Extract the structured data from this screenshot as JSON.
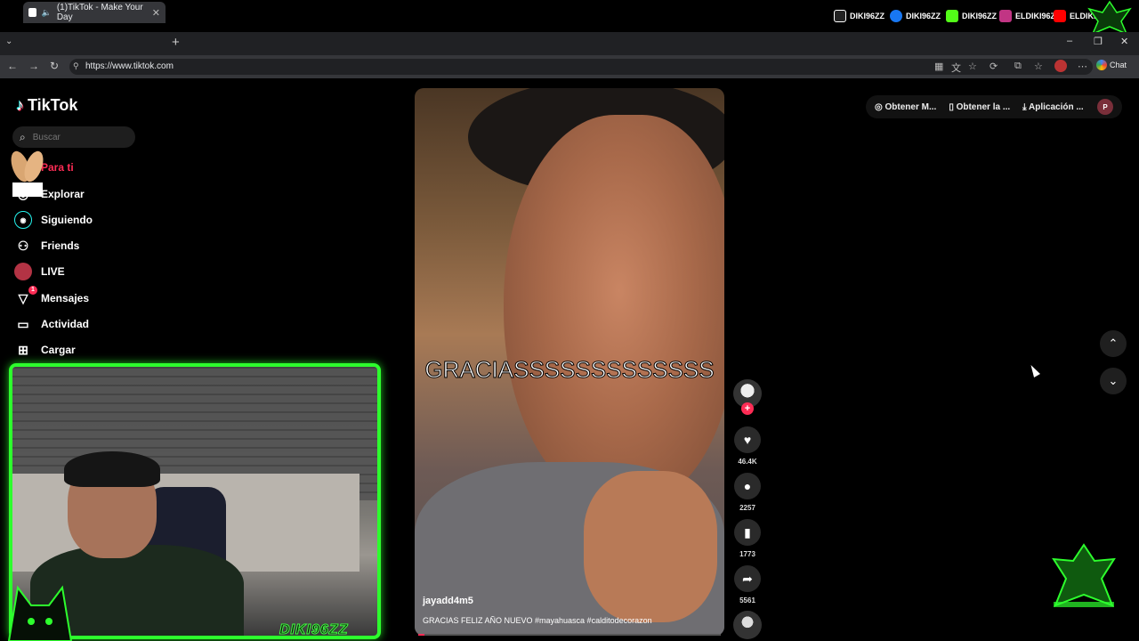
{
  "social_strip": [
    {
      "platform": "tiktok",
      "handle": "DIKI96ZZ",
      "color": "#ffffff"
    },
    {
      "platform": "facebook",
      "handle": "DIKI96ZZ",
      "color": "#1877f2"
    },
    {
      "platform": "kick",
      "handle": "DIKI96ZZ",
      "color": "#53fc18"
    },
    {
      "platform": "instagram",
      "handle": "ELDIKI96ZZ",
      "color": "#c13584"
    },
    {
      "platform": "youtube",
      "handle": "ELDIKI",
      "color": "#ff0000"
    }
  ],
  "browser": {
    "tab_title": "(1)TikTok - Make Your Day",
    "url": "https://www.tiktok.com",
    "chat_label": "Chat"
  },
  "sidebar": {
    "brand": "TikTok",
    "search_placeholder": "Buscar",
    "items": [
      {
        "label": "Para ti",
        "icon": "home-icon",
        "active": true
      },
      {
        "label": "Explorar",
        "icon": "compass-icon"
      },
      {
        "label": "Siguiendo",
        "icon": "following-icon"
      },
      {
        "label": "Friends",
        "icon": "friends-icon"
      },
      {
        "label": "LIVE",
        "icon": "live-icon"
      },
      {
        "label": "Mensajes",
        "icon": "messages-icon",
        "badge": "1"
      },
      {
        "label": "Actividad",
        "icon": "activity-icon"
      },
      {
        "label": "Cargar",
        "icon": "upload-icon"
      }
    ]
  },
  "header": {
    "items": [
      "Obtener M...",
      "Obtener la ...",
      "Aplicación ..."
    ],
    "profile_initial": "P"
  },
  "video": {
    "caption_overlay": "GRACIASSSSSSSSSSSSS",
    "author": "jayadd4m5",
    "description": "GRACIAS FELIZ AÑO NUEVO #mayahuasca #calditodecorazon",
    "progress": 0.02
  },
  "actions": {
    "likes": "46.4K",
    "comments": "2257",
    "saves": "1773",
    "shares": "5561"
  },
  "overlay": {
    "streamer_name": "DIKI96ZZ",
    "accent": "#2dff2d"
  },
  "colors": {
    "tiktok_red": "#fe2c55",
    "tiktok_cyan": "#25f4ee"
  }
}
